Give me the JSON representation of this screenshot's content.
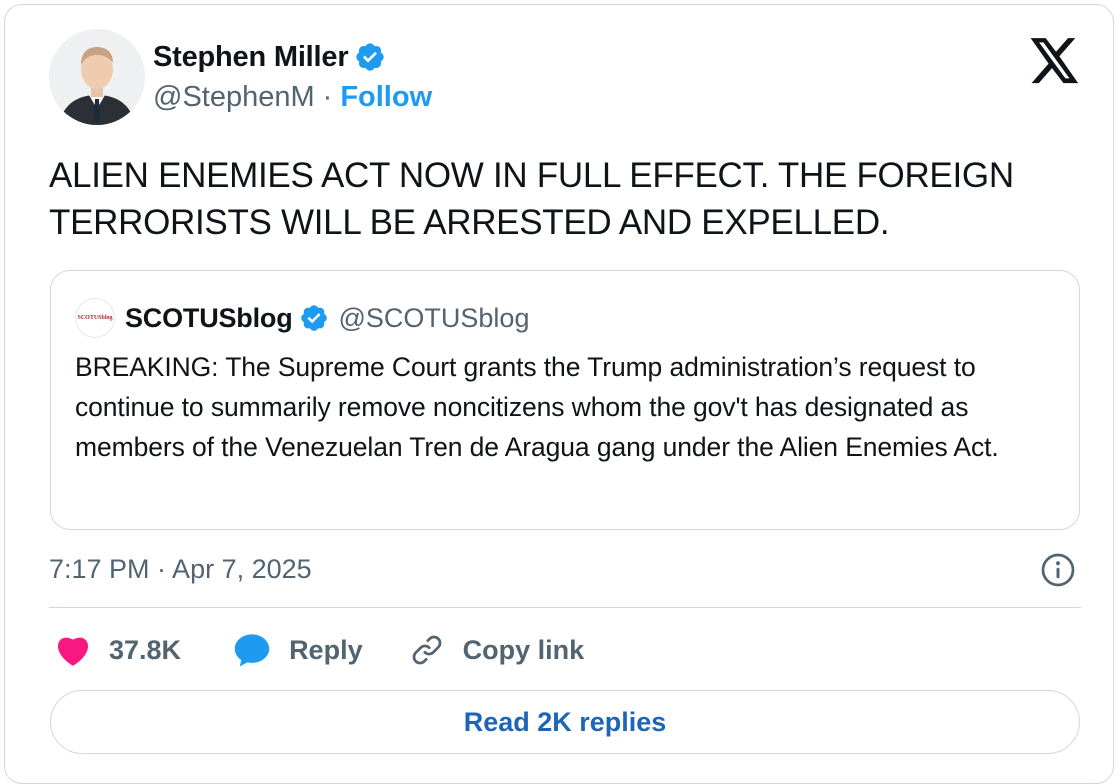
{
  "author": {
    "name": "Stephen Miller",
    "handle": "@StephenM",
    "separator": "·",
    "follow_label": "Follow"
  },
  "tweet": {
    "text": "ALIEN ENEMIES ACT NOW IN FULL EFFECT. THE FOREIGN TERRORISTS WILL BE ARRESTED AND EXPELLED.",
    "timestamp": "7:17 PM · Apr 7, 2025"
  },
  "quote": {
    "avatar_text": "SCOTUSblog",
    "name": "SCOTUSblog",
    "handle": "@SCOTUSblog",
    "text": "BREAKING: The Supreme Court grants the Trump administration’s request to continue to summarily remove noncitizens whom the gov't has designated as members of the Venezuelan Tren de Aragua gang under the Alien Enemies Act."
  },
  "actions": {
    "like_count": "37.8K",
    "reply_label": "Reply",
    "copy_label": "Copy link"
  },
  "read_replies_label": "Read 2K replies",
  "icons": {
    "logo": "x-logo-icon",
    "verified": "verified-badge-icon",
    "info": "info-icon",
    "like": "heart-icon",
    "reply": "speech-bubble-icon",
    "copy": "link-icon"
  },
  "colors": {
    "accent": "#1d9bf0",
    "like": "#f91880",
    "text": "#0f1419",
    "secondary": "#536471",
    "border": "#cfd9de"
  }
}
